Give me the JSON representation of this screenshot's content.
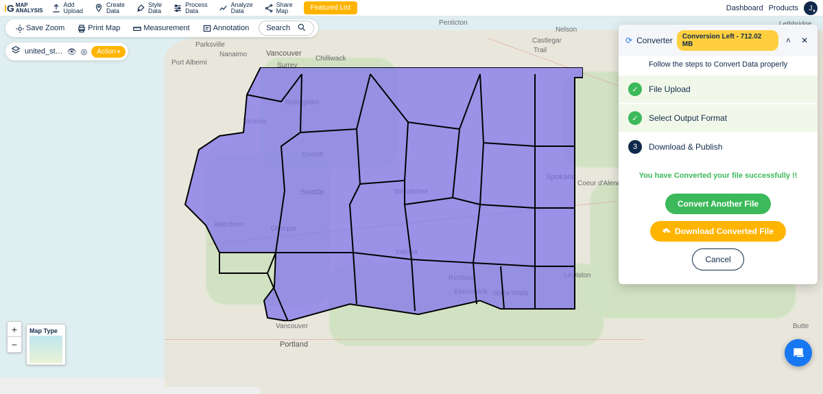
{
  "brand": {
    "mark_left": "I",
    "mark_right": "G",
    "line1": "MAP",
    "line2": "ANALYSIS"
  },
  "topnav": [
    {
      "l1": "Add",
      "l2": "Upload",
      "icon": "upload"
    },
    {
      "l1": "Create",
      "l2": "Data",
      "icon": "pin"
    },
    {
      "l1": "Style",
      "l2": "Data",
      "icon": "brush"
    },
    {
      "l1": "Process",
      "l2": "Data",
      "icon": "sliders"
    },
    {
      "l1": "Analyze",
      "l2": "Data",
      "icon": "analytics"
    },
    {
      "l1": "Share",
      "l2": "Map",
      "icon": "share"
    }
  ],
  "featured_label": "Featured List",
  "header_links": {
    "dashboard": "Dashboard",
    "products": "Products",
    "avatar_initial": "J"
  },
  "secondbar": {
    "save_zoom": "Save Zoom",
    "print_map": "Print Map",
    "measurement": "Measurement",
    "annotation": "Annotation",
    "search": "Search"
  },
  "layer": {
    "name": "united_st…",
    "action": "Action"
  },
  "map_cities": {
    "vancouver": "Vancouver",
    "surrey": "Surrey",
    "nanaimo": "Nanaimo",
    "port_alberni": "Port Alberni",
    "parksville": "Parksville",
    "chilliwack": "Chilliwack",
    "victoria": "Victoria",
    "bellingham": "Bellingham",
    "everett": "Everett",
    "seattle": "Seattle",
    "olympia": "Olympia",
    "aberdeen": "Aberdeen",
    "yakima": "Yakima",
    "wenatchee": "Wenatchee",
    "spokane": "Spokane",
    "richland": "Richland",
    "kennewick": "Kennewick",
    "walla_walla": "Walla Walla",
    "portland": "Portland",
    "vancouver_wa": "Vancouver",
    "penticton": "Penticton",
    "trail": "Trail",
    "nelson": "Nelson",
    "castlegar": "Castlegar",
    "coeur": "Coeur d'Alene",
    "lewiston": "Lewiston",
    "lethbridge": "Lethbridge",
    "butte": "Butte"
  },
  "maptype_label": "Map Type",
  "zoom": {
    "in": "+",
    "out": "−"
  },
  "panel": {
    "title": "Converter",
    "quota": "Conversion Left - 712.02 MB",
    "follow": "Follow the steps to Convert Data properly",
    "steps": {
      "s1": "File Upload",
      "s2": "Select Output Format",
      "s3": "Download & Publish",
      "s3_num": "3"
    },
    "success": "You have Converted your file successfully !!",
    "btn_convert": "Convert Another File",
    "btn_download": "Download Converted File",
    "btn_cancel": "Cancel"
  }
}
